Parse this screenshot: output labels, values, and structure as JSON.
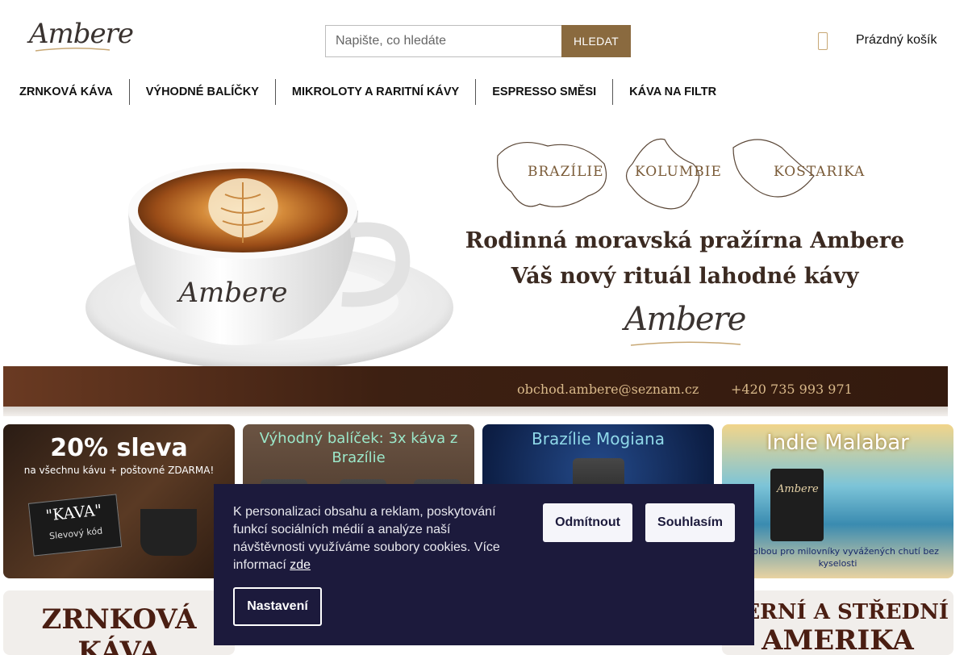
{
  "header": {
    "logo_text": "Ambere",
    "search": {
      "placeholder": "Napište, co hledáte",
      "button_label": "HLEDAT"
    },
    "cart": {
      "label": "Prázdný košík",
      "icon": "cart-icon"
    }
  },
  "nav": {
    "items": [
      {
        "label": "ZRNKOVÁ KÁVA"
      },
      {
        "label": "VÝHODNÉ BALÍČKY"
      },
      {
        "label": "MIKROLOTY A RARITNÍ KÁVY"
      },
      {
        "label": "ESPRESSO SMĚSI"
      },
      {
        "label": "KÁVA NA FILTR"
      }
    ]
  },
  "hero": {
    "countries": [
      "BRAZÍLIE",
      "KOLUMBIE",
      "KOSTARIKA"
    ],
    "headline_1": "Rodinná moravská pražírna Ambere",
    "headline_2": "Váš nový rituál lahodné kávy",
    "logo_text": "Ambere",
    "cup_logo": "Ambere",
    "email": "obchod.ambere@seznam.cz",
    "phone": "+420 735 993 971"
  },
  "tiles": [
    {
      "title": "20% sleva",
      "subtitle": "na všechnu kávu + poštovné ZDARMA!",
      "code": "\"KAVA\"",
      "code_caption": "Slevový kód"
    },
    {
      "title": "Výhodný balíček: 3x káva z Brazílie"
    },
    {
      "title": "Brazílie Mogiana"
    },
    {
      "title": "Indie Malabar",
      "caption": "ní volbou pro milovníky vyvážených chutí bez kyselosti"
    }
  ],
  "categories": [
    {
      "line1": "ZRNKOVÁ",
      "line2": "KÁVA"
    },
    {
      "line1": "VERNÍ A STŘEDNÍ",
      "line2": "AMERIKA"
    }
  ],
  "cookie_banner": {
    "text": "K personalizaci obsahu a reklam, poskytování funkcí sociálních médií a analýze naší návštěvnosti využíváme soubory cookies. Více informací",
    "link_label": "zde",
    "reject_label": "Odmítnout",
    "accept_label": "Souhlasím",
    "settings_label": "Nastavení"
  }
}
